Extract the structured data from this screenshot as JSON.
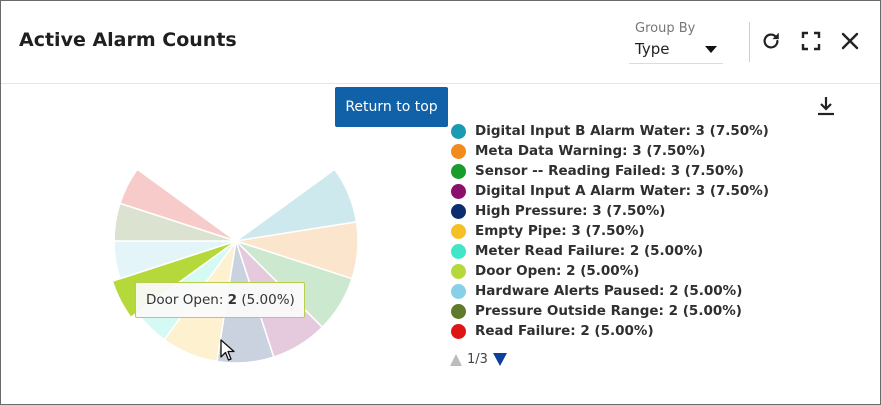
{
  "widget": {
    "title": "Active Alarm Counts",
    "group_by_label": "Group By",
    "group_by_value": "Type",
    "return_to_top_label": "Return to top"
  },
  "icons": {
    "refresh": "refresh-icon",
    "fullscreen": "fullscreen-icon",
    "close": "close-icon",
    "download": "download-icon"
  },
  "chart_data": {
    "type": "pie",
    "highlighted": "Door Open",
    "series": [
      {
        "name": "Digital Input B Alarm Water",
        "value": 3,
        "percent": 7.5,
        "color": "#1a9bb1"
      },
      {
        "name": "Meta Data Warning",
        "value": 3,
        "percent": 7.5,
        "color": "#f28a1c"
      },
      {
        "name": "Sensor -- Reading Failed",
        "value": 3,
        "percent": 7.5,
        "color": "#189c2a"
      },
      {
        "name": "Digital Input A Alarm Water",
        "value": 3,
        "percent": 7.5,
        "color": "#8b0f6b"
      },
      {
        "name": "High Pressure",
        "value": 3,
        "percent": 7.5,
        "color": "#0d2e6e"
      },
      {
        "name": "Empty Pipe",
        "value": 3,
        "percent": 7.5,
        "color": "#f5c023"
      },
      {
        "name": "Meter Read Failure",
        "value": 2,
        "percent": 5.0,
        "color": "#3fe6c8"
      },
      {
        "name": "Door Open",
        "value": 2,
        "percent": 5.0,
        "color": "#b5d93a"
      },
      {
        "name": "Hardware Alerts Paused",
        "value": 2,
        "percent": 5.0,
        "color": "#86d0e8"
      },
      {
        "name": "Pressure Outside Range",
        "value": 2,
        "percent": 5.0,
        "color": "#5f7a28"
      },
      {
        "name": "Read Failure",
        "value": 2,
        "percent": 5.0,
        "color": "#e01414"
      }
    ],
    "legend_entries": [
      "Digital Input B Alarm Water: 3 (7.50%)",
      "Meta Data Warning: 3 (7.50%)",
      "Sensor -- Reading Failed: 3 (7.50%)",
      "Digital Input A Alarm Water: 3 (7.50%)",
      "High Pressure: 3 (7.50%)",
      "Empty Pipe: 3 (7.50%)",
      "Meter Read Failure: 2 (5.00%)",
      "Door Open: 2 (5.00%)",
      "Hardware Alerts Paused: 2 (5.00%)",
      "Pressure Outside Range: 2 (5.00%)",
      "Read Failure: 2 (5.00%)"
    ],
    "tooltip": {
      "name": "Door Open:",
      "value": "2",
      "percent": "(5.00%)"
    },
    "legend_page": "1/3"
  }
}
